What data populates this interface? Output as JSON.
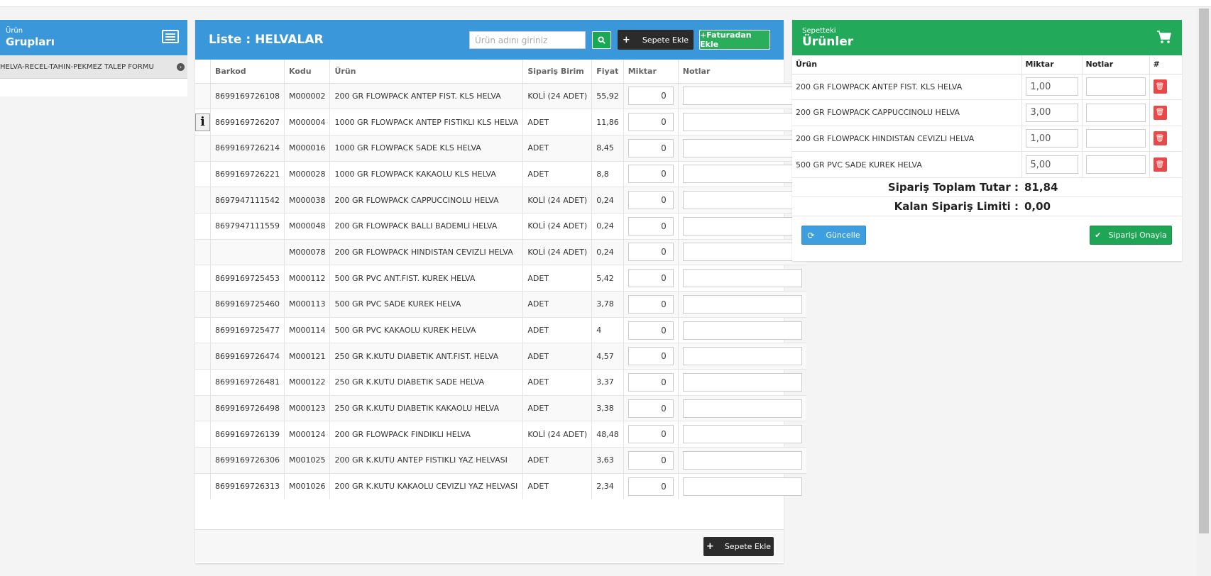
{
  "groups": {
    "title_small": "Ürün",
    "title_big": "Grupları",
    "items": [
      {
        "label": "HELVA-RECEL-TAHIN-PEKMEZ TALEP FORMU"
      }
    ]
  },
  "list": {
    "title": "Liste : HELVALAR",
    "search_placeholder": "Ürün adını giriniz",
    "add_to_cart_label": "Sepete Ekle",
    "add_from_invoice_label": "+Faturadan Ekle",
    "bottom_add_label": "Sepete Ekle",
    "columns": [
      "Barkod",
      "Kodu",
      "Ürün",
      "Sipariş Birim",
      "Fiyat",
      "Miktar",
      "Notlar"
    ],
    "rows": [
      {
        "barkod": "8699169726108",
        "kodu": "M000002",
        "urun": "200 GR FLOWPACK ANTEP FIST. KLS HELVA",
        "birim": "KOLİ (24 ADET)",
        "fiyat": "55,92",
        "miktar": "0"
      },
      {
        "barkod": "8699169726207",
        "kodu": "M000004",
        "urun": "1000 GR FLOWPACK ANTEP FISTIKLI KLS HELVA",
        "birim": "ADET",
        "fiyat": "11,86",
        "miktar": "0"
      },
      {
        "barkod": "8699169726214",
        "kodu": "M000016",
        "urun": "1000 GR FLOWPACK SADE KLS HELVA",
        "birim": "ADET",
        "fiyat": "8,45",
        "miktar": "0"
      },
      {
        "barkod": "8699169726221",
        "kodu": "M000028",
        "urun": "1000 GR FLOWPACK KAKAOLU KLS HELVA",
        "birim": "ADET",
        "fiyat": "8,8",
        "miktar": "0"
      },
      {
        "barkod": "8697947111542",
        "kodu": "M000038",
        "urun": "200 GR FLOWPACK CAPPUCCINOLU HELVA",
        "birim": "KOLİ (24 ADET)",
        "fiyat": "0,24",
        "miktar": "0"
      },
      {
        "barkod": "8697947111559",
        "kodu": "M000048",
        "urun": "200 GR FLOWPACK BALLI BADEMLI HELVA",
        "birim": "KOLİ (24 ADET)",
        "fiyat": "0,24",
        "miktar": "0"
      },
      {
        "barkod": "",
        "kodu": "M000078",
        "urun": "200 GR FLOWPACK HINDISTAN CEVIZLI HELVA",
        "birim": "KOLİ (24 ADET)",
        "fiyat": "0,24",
        "miktar": "0"
      },
      {
        "barkod": "8699169725453",
        "kodu": "M000112",
        "urun": "500 GR PVC ANT.FIST. KUREK HELVA",
        "birim": "ADET",
        "fiyat": "5,42",
        "miktar": "0"
      },
      {
        "barkod": "8699169725460",
        "kodu": "M000113",
        "urun": "500 GR PVC SADE KUREK HELVA",
        "birim": "ADET",
        "fiyat": "3,78",
        "miktar": "0"
      },
      {
        "barkod": "8699169725477",
        "kodu": "M000114",
        "urun": "500 GR PVC KAKAOLU KUREK HELVA",
        "birim": "ADET",
        "fiyat": "4",
        "miktar": "0"
      },
      {
        "barkod": "8699169726474",
        "kodu": "M000121",
        "urun": "250 GR K.KUTU DIABETIK ANT.FIST. HELVA",
        "birim": "ADET",
        "fiyat": "4,57",
        "miktar": "0"
      },
      {
        "barkod": "8699169726481",
        "kodu": "M000122",
        "urun": "250 GR K.KUTU DIABETIK SADE HELVA",
        "birim": "ADET",
        "fiyat": "3,37",
        "miktar": "0"
      },
      {
        "barkod": "8699169726498",
        "kodu": "M000123",
        "urun": "250 GR K.KUTU DIABETIK KAKAOLU HELVA",
        "birim": "ADET",
        "fiyat": "3,38",
        "miktar": "0"
      },
      {
        "barkod": "8699169726139",
        "kodu": "M000124",
        "urun": "200 GR FLOWPACK FINDIKLI HELVA",
        "birim": "KOLİ (24 ADET)",
        "fiyat": "48,48",
        "miktar": "0"
      },
      {
        "barkod": "8699169726306",
        "kodu": "M001025",
        "urun": "200 GR K.KUTU ANTEP FISTIKLI YAZ HELVASI",
        "birim": "ADET",
        "fiyat": "3,63",
        "miktar": "0"
      },
      {
        "barkod": "8699169726313",
        "kodu": "M001026",
        "urun": "200 GR K.KUTU KAKAOLU CEVIZLI YAZ HELVASI",
        "birim": "ADET",
        "fiyat": "2,34",
        "miktar": "0"
      }
    ]
  },
  "cart": {
    "title_small": "Sepetteki",
    "title_big": "Ürünler",
    "columns": [
      "Ürün",
      "Miktar",
      "Notlar",
      "#"
    ],
    "items": [
      {
        "urun": "200 GR FLOWPACK ANTEP FIST. KLS HELVA",
        "miktar": "1,00"
      },
      {
        "urun": "200 GR FLOWPACK CAPPUCCINOLU HELVA",
        "miktar": "3,00"
      },
      {
        "urun": "200 GR FLOWPACK HINDISTAN CEVIZLI HELVA",
        "miktar": "1,00"
      },
      {
        "urun": "500 GR PVC SADE KUREK HELVA",
        "miktar": "5,00"
      }
    ],
    "total_label": "Sipariş Toplam Tutar :",
    "total_value": "81,84",
    "limit_label": "Kalan Sipariş Limiti :",
    "limit_value": "0,00",
    "update_label": "Güncelle",
    "confirm_label": "Siparişi Onayla"
  },
  "colors": {
    "list_header": "#3a97d9",
    "cart_header": "#22aa5a",
    "delete": "#e84848"
  }
}
